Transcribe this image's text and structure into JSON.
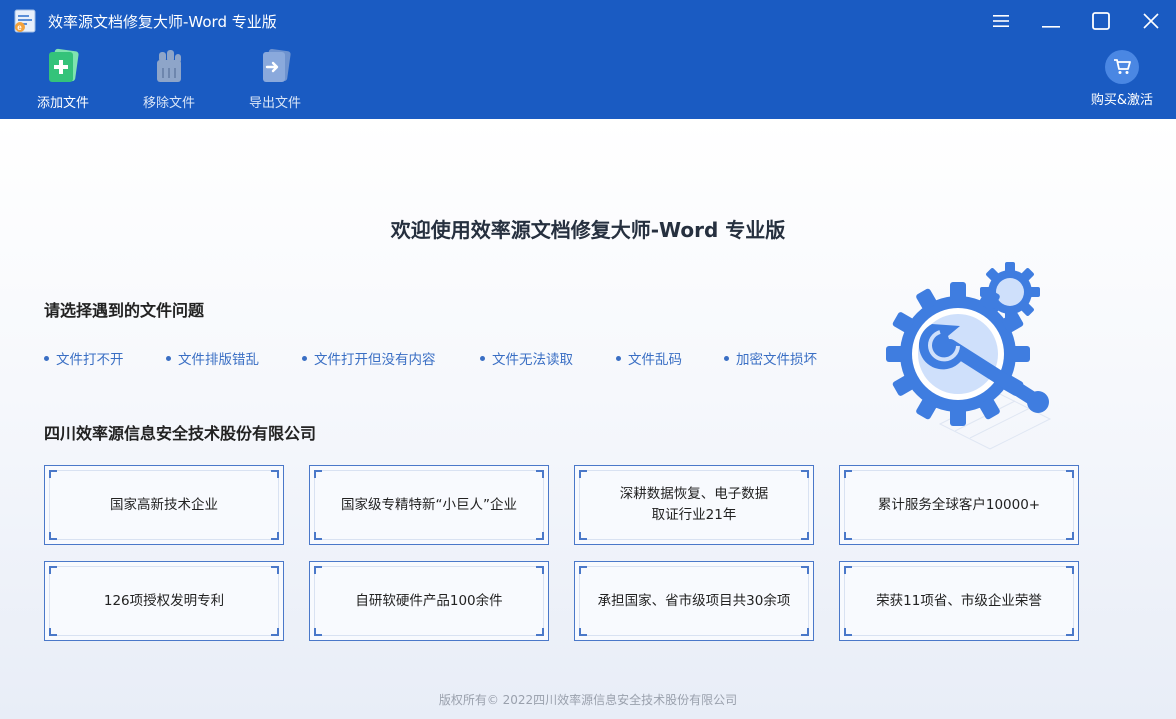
{
  "window": {
    "title": "效率源文档修复大师-Word 专业版",
    "controls": [
      "menu-icon",
      "minimize-icon",
      "maximize-icon",
      "close-icon"
    ]
  },
  "toolbar": {
    "add_label": "添加文件",
    "remove_label": "移除文件",
    "export_label": "导出文件",
    "buy_label": "购买&激活"
  },
  "main": {
    "welcome": "欢迎使用效率源文档修复大师-Word 专业版",
    "problems_title": "请选择遇到的文件问题",
    "problems": [
      "文件打不开",
      "文件排版错乱",
      "文件打开但没有内容",
      "文件无法读取",
      "文件乱码",
      "加密文件损坏"
    ],
    "company_title": "四川效率源信息安全技术股份有限公司",
    "cards": [
      "国家高新技术企业",
      "国家级专精特新“小巨人”企业",
      "深耕数据恢复、电子数据\n取证行业21年",
      "累计服务全球客户10000+",
      "126项授权发明专利",
      "自研软硬件产品100余件",
      "承担国家、省市级项目共30余项",
      "荣获11项省、市级企业荣誉"
    ]
  },
  "footer": {
    "copyright": "版权所有© 2022四川效率源信息安全技术股份有限公司"
  },
  "colors": {
    "header_bg": "#1a5bc2",
    "accent": "#3a6fc4",
    "card_border": "#4a78c9"
  }
}
